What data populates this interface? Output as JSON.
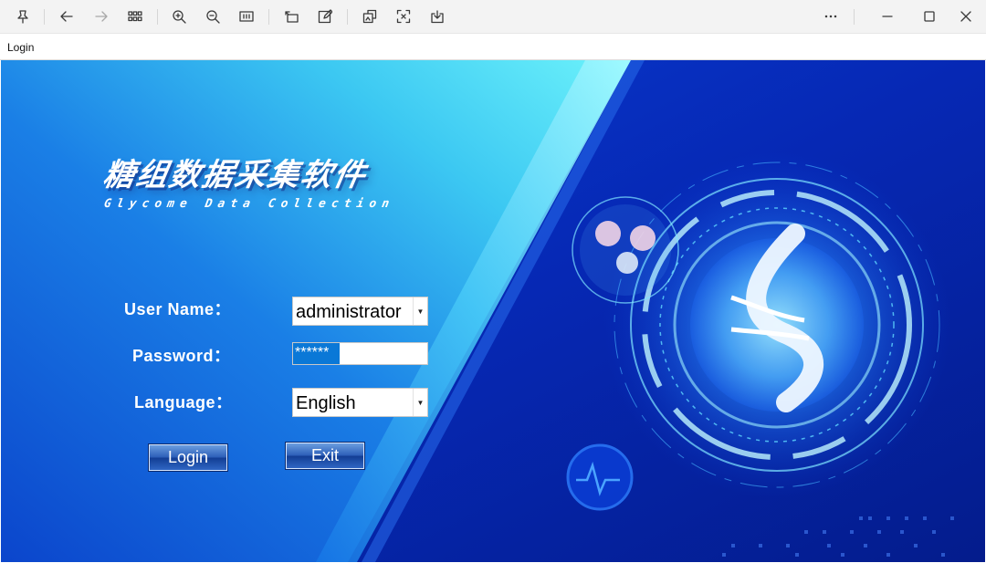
{
  "toolbar": {
    "icons": [
      "pin-icon",
      "back-arrow-icon",
      "forward-arrow-icon",
      "gallery-grid-icon",
      "zoom-in-icon",
      "zoom-out-icon",
      "fit-window-icon",
      "rotate-icon",
      "edit-icon",
      "enhance-icon",
      "crop-icon",
      "save-icon",
      "more-icon",
      "minimize-icon",
      "maximize-icon",
      "close-icon"
    ]
  },
  "window": {
    "title": "Login"
  },
  "branding": {
    "title_cn": "糖组数据采集软件",
    "title_en": "Glycome Data Collection"
  },
  "form": {
    "user_label": "User Name：",
    "user_value": "administrator",
    "password_label": "Password：",
    "password_value": "******",
    "language_label": "Language：",
    "language_value": "English",
    "login_label": "Login",
    "exit_label": "Exit"
  },
  "colors": {
    "accent": "#0a78d7",
    "background": "#0833c8"
  }
}
